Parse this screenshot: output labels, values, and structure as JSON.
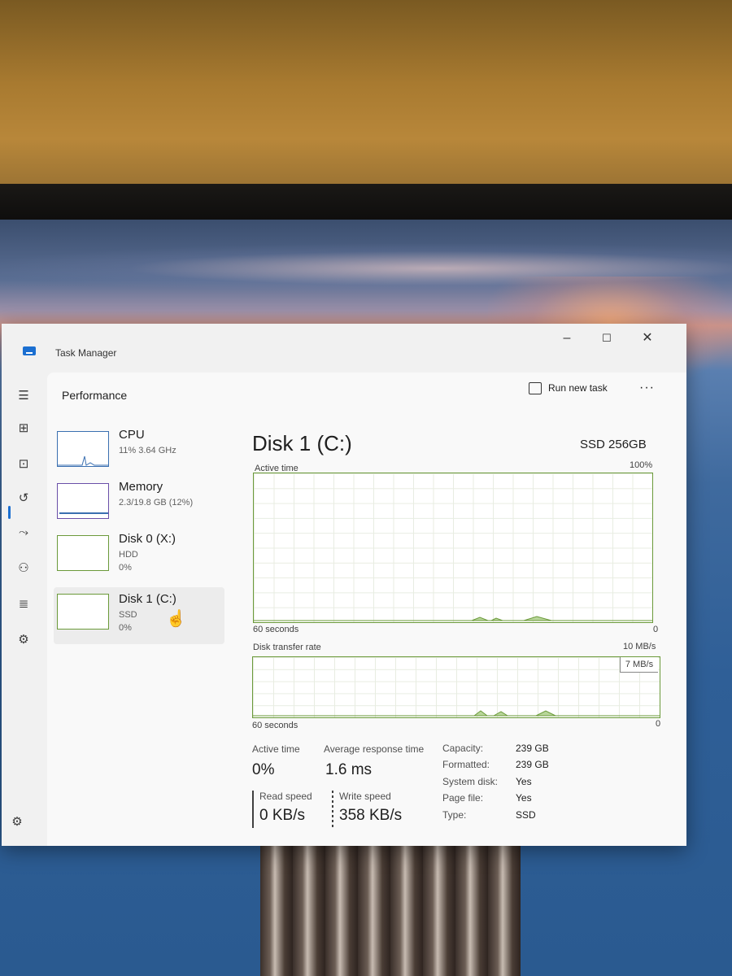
{
  "window": {
    "title": "Task Manager",
    "controls": [
      "–",
      "☐",
      "✕"
    ]
  },
  "header": {
    "page_title": "Performance",
    "run_new_task": "Run new task",
    "more": "···"
  },
  "devices": [
    {
      "name": "CPU",
      "line1": "11% 3.64 GHz",
      "line2": ""
    },
    {
      "name": "Memory",
      "line1": "2.3/19.8 GB (12%)",
      "line2": ""
    },
    {
      "name": "Disk 0 (X:)",
      "line1": "HDD",
      "line2": "0%"
    },
    {
      "name": "Disk 1 (C:)",
      "line1": "SSD",
      "line2": "0%"
    }
  ],
  "detail": {
    "title": "Disk 1 (C:)",
    "model": "SSD 256GB",
    "active_time_label": "Active time",
    "active_time_max": "100%",
    "active_time_xlabel": "60 seconds",
    "active_time_min": "0",
    "transfer_label": "Disk transfer rate",
    "transfer_max": "10 MB/s",
    "transfer_scale": "7 MB/s",
    "transfer_xlabel": "60 seconds",
    "transfer_min": "0"
  },
  "stats": {
    "active_time_label": "Active time",
    "active_time_value": "0%",
    "avg_response_label": "Average response time",
    "avg_response_value": "1.6 ms",
    "read_speed_label": "Read speed",
    "read_speed_value": "0 KB/s",
    "write_speed_label": "Write speed",
    "write_speed_value": "358 KB/s"
  },
  "properties": [
    {
      "key": "Capacity:",
      "value": "239 GB"
    },
    {
      "key": "Formatted:",
      "value": "239 GB"
    },
    {
      "key": "System disk:",
      "value": "Yes"
    },
    {
      "key": "Page file:",
      "value": "Yes"
    },
    {
      "key": "Type:",
      "value": "SSD"
    }
  ],
  "colors": {
    "disk_accent": "#6b9a3a",
    "cpu_accent": "#3a6fb0",
    "memory_accent": "#6a4fa8",
    "selection_accent": "#1b6fd1"
  },
  "icons": {
    "rail": [
      "hamburger-menu-icon",
      "processes-icon",
      "performance-icon",
      "app-history-icon",
      "startup-apps-icon",
      "users-icon",
      "details-icon",
      "services-icon",
      "settings-icon"
    ]
  }
}
